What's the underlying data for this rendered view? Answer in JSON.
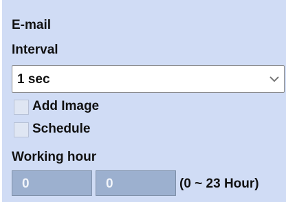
{
  "email": {
    "section_label": "E-mail",
    "interval": {
      "label": "Interval",
      "selected": "1 sec",
      "dropdown_icon": "chevron-down-icon"
    },
    "add_image": {
      "label": "Add Image",
      "checked": false
    },
    "schedule": {
      "label": "Schedule",
      "checked": false
    },
    "working_hour": {
      "label": "Working hour",
      "start_value": "0",
      "end_value": "0",
      "range_hint": "(0 ~ 23 Hour)"
    }
  },
  "colors": {
    "panel_background": "#d0dcf5",
    "disabled_field": "#9cb0cf"
  }
}
